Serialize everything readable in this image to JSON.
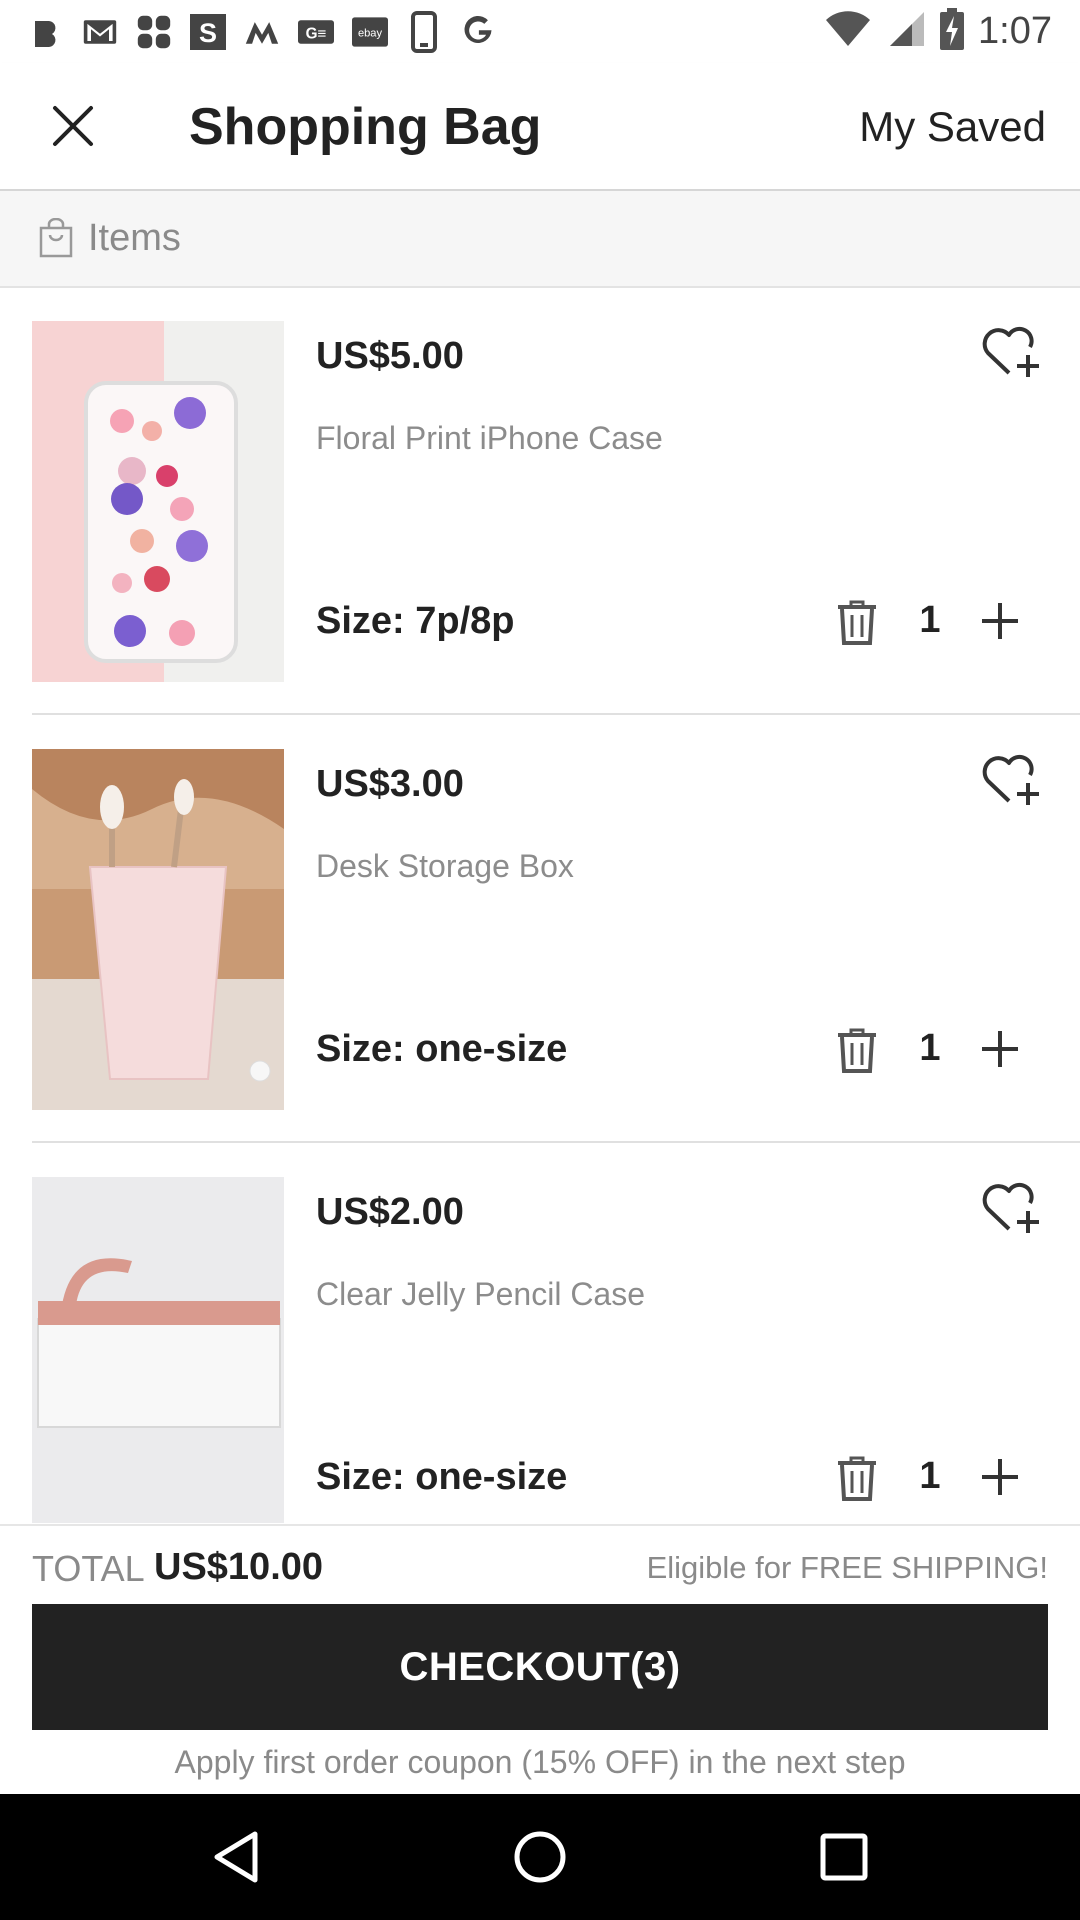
{
  "status_bar": {
    "time": "1:07",
    "notification_icons": [
      "b-app-icon",
      "gmail-icon",
      "pinwheel-app-icon",
      "s-app-icon",
      "m-app-icon",
      "ge-app-icon",
      "ebay-icon",
      "phone-app-icon",
      "google-icon"
    ],
    "ebay_text": "ebay"
  },
  "app_bar": {
    "title": "Shopping Bag",
    "my_saved_label": "My Saved"
  },
  "section": {
    "label": "Items"
  },
  "items": [
    {
      "price": "US$5.00",
      "name": "Floral Print iPhone Case",
      "size": "Size: 7p/8p",
      "quantity": "1"
    },
    {
      "price": "US$3.00",
      "name": "Desk Storage Box",
      "size": "Size: one-size",
      "quantity": "1"
    },
    {
      "price": "US$2.00",
      "name": "Clear Jelly Pencil Case",
      "size": "Size: one-size",
      "quantity": "1"
    }
  ],
  "footer": {
    "total_label": "TOTAL",
    "total_value": "US$10.00",
    "shipping_note": "Eligible for FREE SHIPPING!",
    "checkout_label": "CHECKOUT(3)",
    "coupon_note": "Apply first order coupon (15% OFF) in the next step"
  },
  "colors": {
    "checkout_bg": "#222222",
    "header_bg": "#f6f6f6",
    "muted_text": "#8a8a8a",
    "primary_text": "#222222"
  }
}
